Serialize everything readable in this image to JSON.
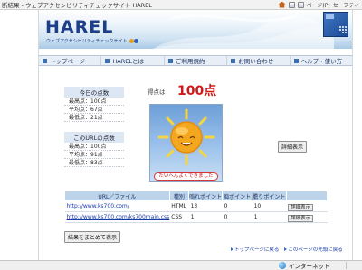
{
  "browser": {
    "title": "断結果 - ウェブアクセシビリティチェックサイト HAREL",
    "toolbar": [
      "ページ(P)",
      "セーフティ"
    ],
    "status": "インターネット"
  },
  "header": {
    "logo": "HAREL",
    "subtitle": "ウェブアクセシビリティチェックサイト"
  },
  "nav": [
    {
      "label": "トップページ"
    },
    {
      "label": "HARELとは"
    },
    {
      "label": "ご利用規約"
    },
    {
      "label": "お問い合わせ"
    },
    {
      "label": "ヘルプ・使い方"
    }
  ],
  "today_panel": {
    "title": "今日の点数",
    "rows": [
      "最高点：100点",
      "平均点：67点",
      "最低点：21点"
    ]
  },
  "url_panel": {
    "title": "このURLの点数",
    "rows": [
      "最高点：100点",
      "平均点：91点",
      "最低点：83点"
    ]
  },
  "score": {
    "label": "得点は",
    "value": "100点",
    "caption": "たいへんよくできました"
  },
  "detail_button": "詳細表示",
  "table": {
    "headers": [
      "URL／ファイル",
      "種別",
      "嗚れポイント",
      "痴ポイント",
      "膽りポイント",
      ""
    ],
    "rows": [
      {
        "url": "http://www.ks700.com/",
        "type": "HTML",
        "p1": "13",
        "p2": "0",
        "p3": "10",
        "button": "詳細表示"
      },
      {
        "url": "http://www.ks700.com/ks700main.css",
        "type": "CSS",
        "p1": "1",
        "p2": "0",
        "p3": "1",
        "button": "詳細表示"
      }
    ]
  },
  "summary_button": "結果をまとめて表示",
  "footer": {
    "link1": "トップページに戻る",
    "link2": "このページの先頭に戻る"
  }
}
